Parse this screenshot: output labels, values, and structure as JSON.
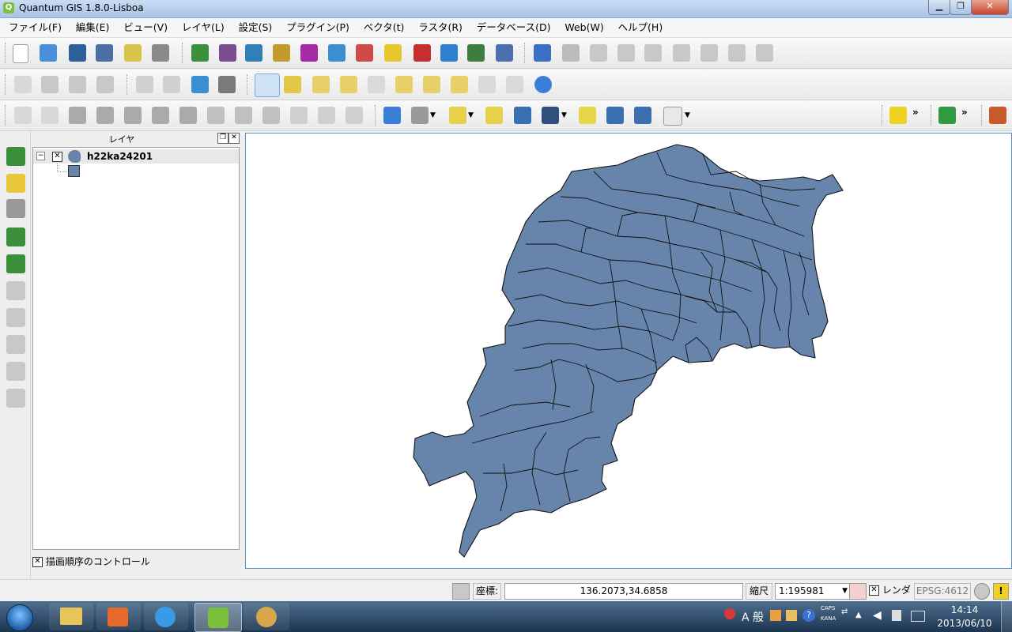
{
  "window": {
    "title": "Quantum GIS 1.8.0-Lisboa"
  },
  "menu": [
    "ファイル(F)",
    "編集(E)",
    "ビュー(V)",
    "レイヤ(L)",
    "設定(S)",
    "プラグイン(P)",
    "ベクタ(t)",
    "ラスタ(R)",
    "データベース(D)",
    "Web(W)",
    "ヘルプ(H)"
  ],
  "layer_panel": {
    "title": "レイヤ",
    "layers": [
      {
        "name": "h22ka24201",
        "checked": true,
        "color": "#6784ab"
      }
    ],
    "draw_order_label": "描画順序のコントロール"
  },
  "statusbar": {
    "coord_label": "座標:",
    "coordinate": "136.2073,34.6858",
    "scale_label": "縮尺",
    "scale": "1:195981",
    "render_label": "レンダ",
    "crs": "EPSG:4612"
  },
  "taskbar": {
    "time": "14:14",
    "date": "2013/06/10",
    "ime_label": "A 般",
    "caps": "CAPS",
    "kana": "KANA"
  },
  "colors": {
    "polygon_fill": "#6784ab",
    "polygon_stroke": "#111111",
    "map_border": "#5a8cc8"
  }
}
